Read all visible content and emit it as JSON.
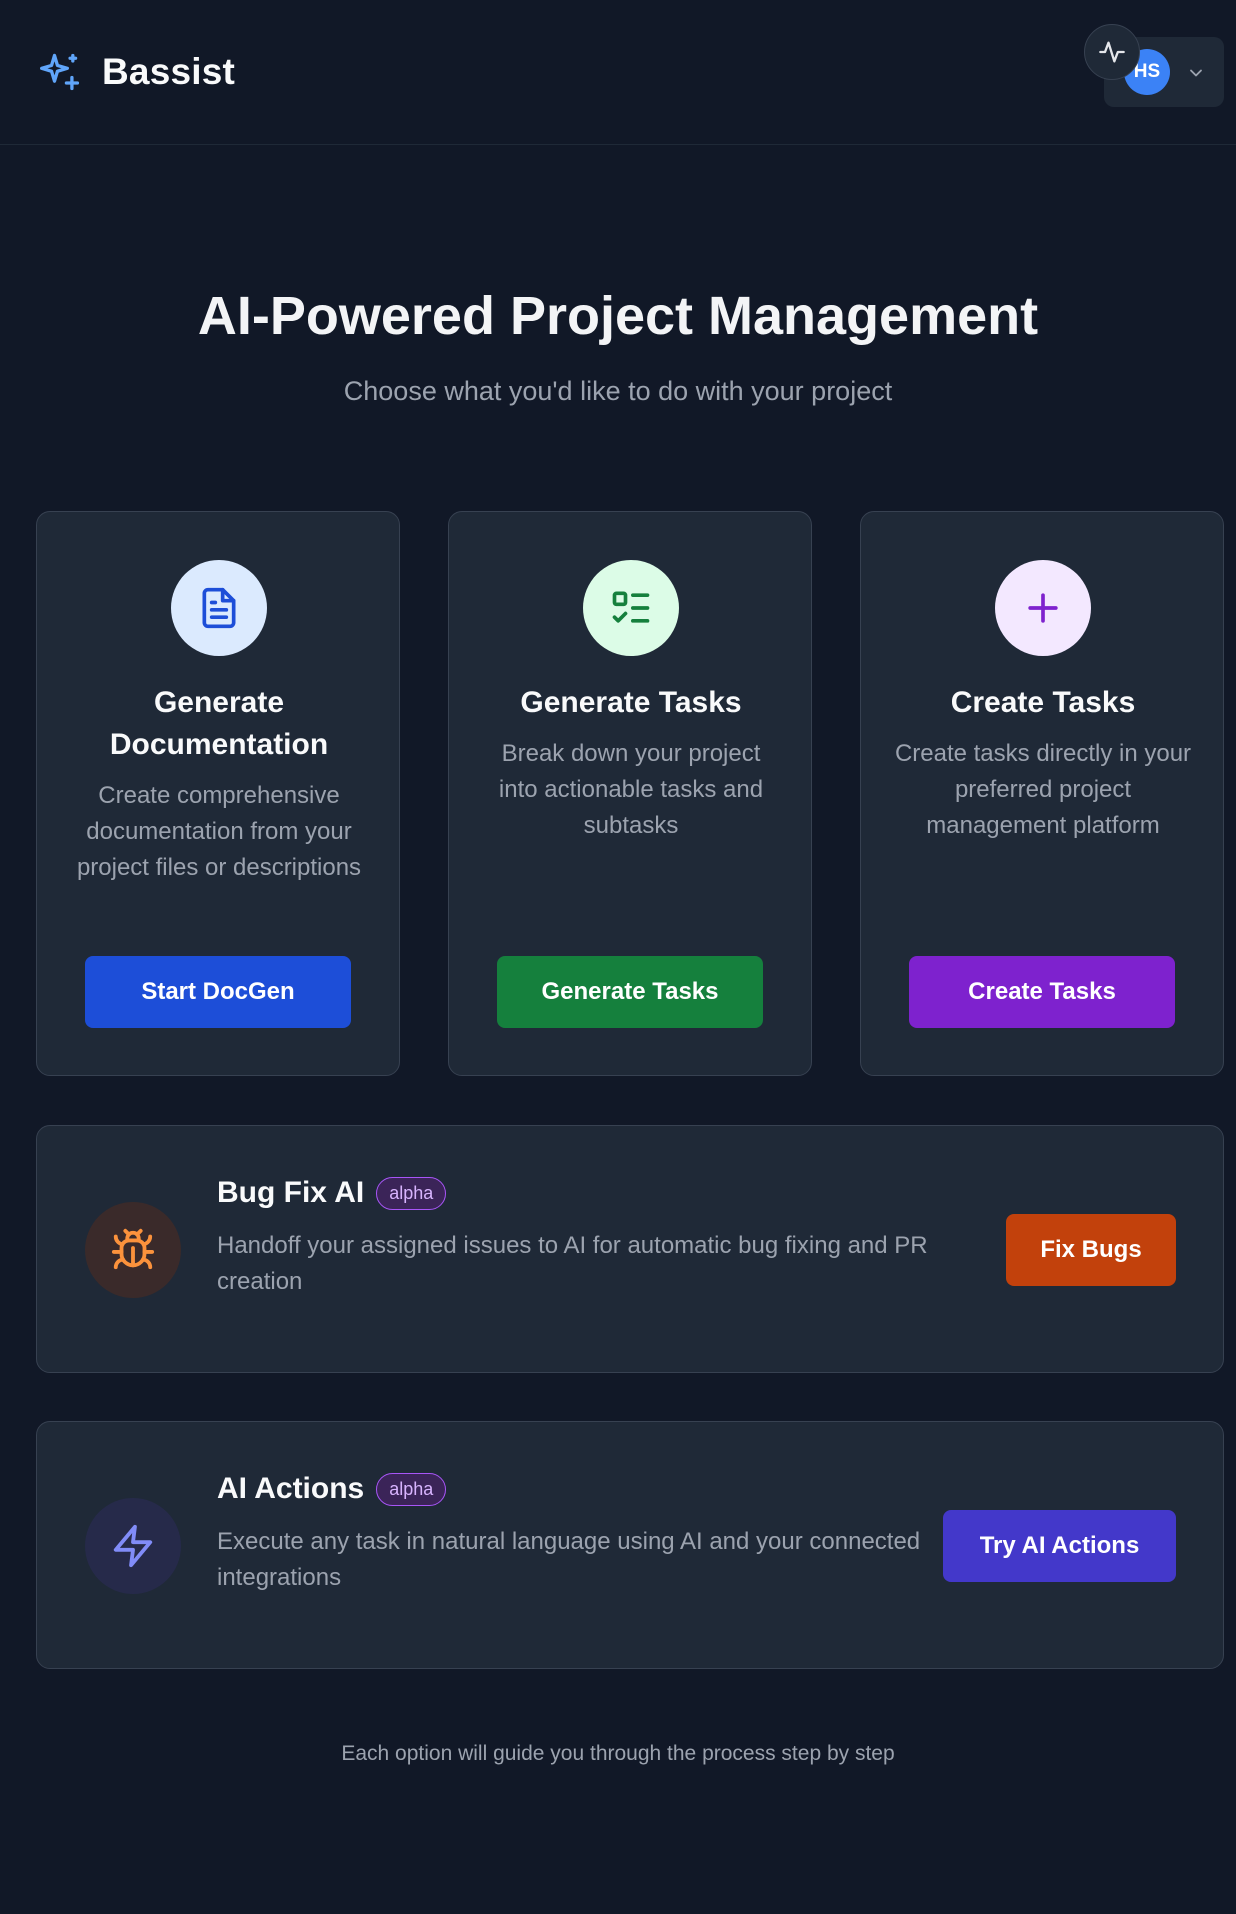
{
  "app": {
    "name": "Bassist",
    "logo_icon": "sparkles-icon"
  },
  "user": {
    "initials": "HS"
  },
  "hero": {
    "title": "AI-Powered Project Management",
    "subtitle": "Choose what you'd like to do with your project"
  },
  "cards": [
    {
      "title": "Generate Documentation",
      "description": "Create comprehensive documentation from your project files or descriptions",
      "button": "Start DocGen",
      "icon": "document-icon",
      "accent": "#1d4ed8",
      "circle_bg": "#dbeafe"
    },
    {
      "title": "Generate Tasks",
      "description": "Break down your project into actionable tasks and subtasks",
      "button": "Generate Tasks",
      "icon": "checklist-icon",
      "accent": "#15803d",
      "circle_bg": "#dcfce7"
    },
    {
      "title": "Create Tasks",
      "description": "Create tasks directly in your preferred project management platform",
      "button": "Create Tasks",
      "icon": "plus-icon",
      "accent": "#7e22ce",
      "circle_bg": "#f3e8ff"
    }
  ],
  "features": [
    {
      "title": "Bug Fix AI",
      "badge": "alpha",
      "description": "Handoff your assigned issues to AI for automatic bug fixing and PR creation",
      "button": "Fix Bugs",
      "icon": "bug-icon",
      "accent": "#c2410c"
    },
    {
      "title": "AI Actions",
      "badge": "alpha",
      "description": "Execute any task in natural language using AI and your connected integrations",
      "button": "Try AI Actions",
      "icon": "lightning-icon",
      "accent": "#4338ca"
    }
  ],
  "footer": {
    "note": "Each option will guide you through the process step by step"
  }
}
